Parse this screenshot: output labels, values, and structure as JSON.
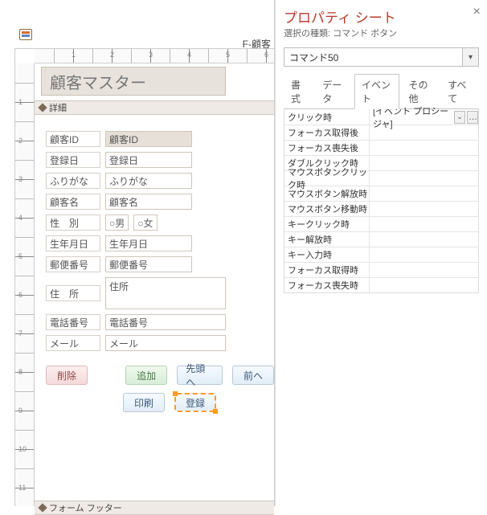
{
  "form_tab": "F-顧客",
  "form_header_title": "顧客マスター",
  "section_detail": "詳細",
  "section_footer": "フォーム フッター",
  "rows": {
    "id": {
      "label": "顧客ID",
      "field": "顧客ID"
    },
    "reg": {
      "label": "登録日",
      "field": "登録日"
    },
    "kana": {
      "label": "ふりがな",
      "field": "ふりがな"
    },
    "name": {
      "label": "顧客名",
      "field": "顧客名"
    },
    "sex": {
      "label": "性　別",
      "opt_m": "○男",
      "opt_f": "○女"
    },
    "birth": {
      "label": "生年月日",
      "field": "生年月日"
    },
    "zip": {
      "label": "郵便番号",
      "field": "郵便番号"
    },
    "addr": {
      "label": "住　所",
      "field": "住所"
    },
    "tel": {
      "label": "電話番号",
      "field": "電話番号"
    },
    "mail": {
      "label": "メール",
      "field": "メール"
    }
  },
  "buttons": {
    "delete": "削除",
    "add": "追加",
    "first": "先頭へ",
    "prev": "前へ",
    "print": "印刷",
    "register": "登録"
  },
  "ruler_h": [
    "1",
    "2",
    "3",
    "4",
    "5",
    "6"
  ],
  "ruler_v": [
    "1",
    "2",
    "3",
    "4",
    "5",
    "6",
    "7",
    "8",
    "9",
    "10",
    "11"
  ],
  "property_sheet": {
    "title": "プロパティ シート",
    "subtitle": "選択の種類: コマンド ボタン",
    "object": "コマンド50",
    "tabs": [
      "書式",
      "データ",
      "イベント",
      "その他",
      "すべて"
    ],
    "active_tab": 2,
    "props": [
      {
        "name": "クリック時",
        "value": "[イベント プロシージャ]",
        "has_dd": true,
        "has_builder": true
      },
      {
        "name": "フォーカス取得後"
      },
      {
        "name": "フォーカス喪失後"
      },
      {
        "name": "ダブルクリック時"
      },
      {
        "name": "マウスボタンクリック時"
      },
      {
        "name": "マウスボタン解放時"
      },
      {
        "name": "マウスボタン移動時"
      },
      {
        "name": "キークリック時"
      },
      {
        "name": "キー解放時"
      },
      {
        "name": "キー入力時"
      },
      {
        "name": "フォーカス取得時"
      },
      {
        "name": "フォーカス喪失時"
      }
    ]
  }
}
